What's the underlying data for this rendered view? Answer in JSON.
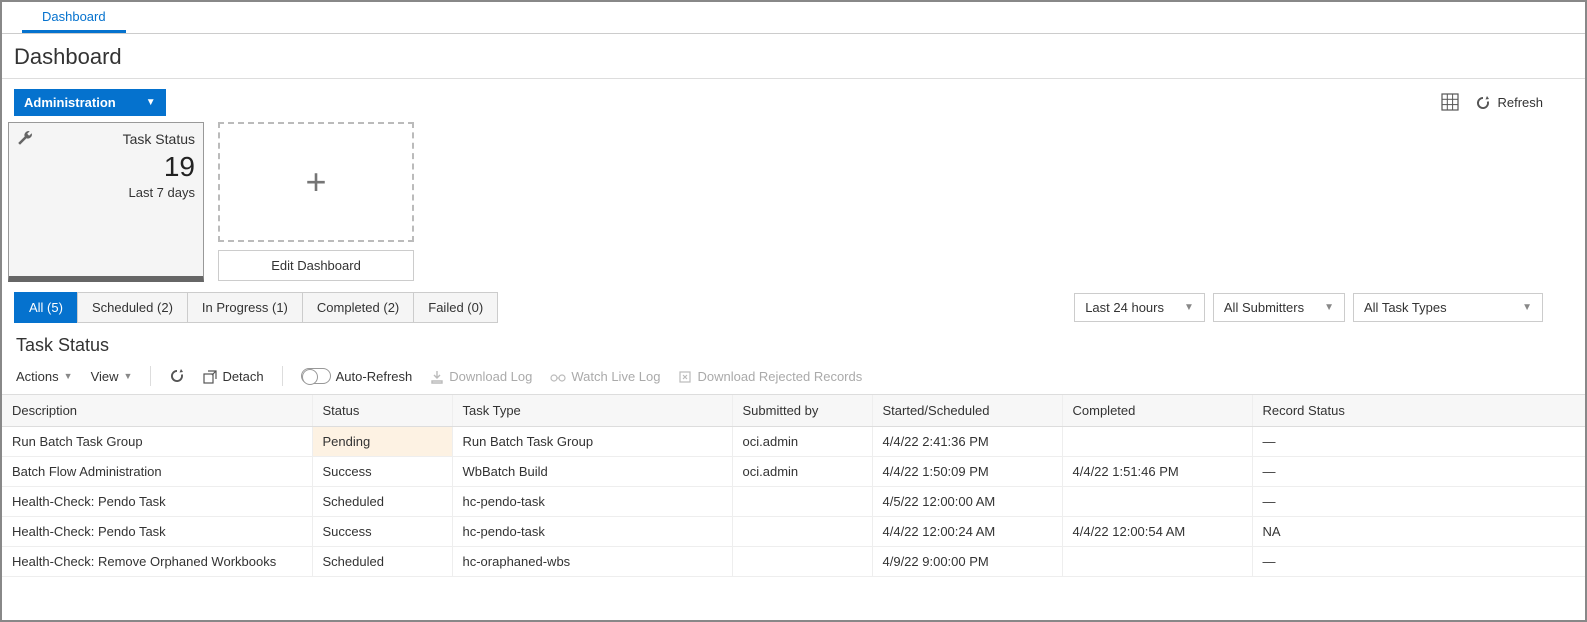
{
  "top_tab": "Dashboard",
  "page_title": "Dashboard",
  "admin_dropdown": "Administration",
  "refresh_label": "Refresh",
  "tile": {
    "title": "Task Status",
    "number": "19",
    "subtitle": "Last 7 days"
  },
  "edit_dashboard": "Edit Dashboard",
  "filter_tabs": {
    "all": "All (5)",
    "scheduled": "Scheduled (2)",
    "inprogress": "In Progress (1)",
    "completed": "Completed (2)",
    "failed": "Failed (0)"
  },
  "selects": {
    "time": "Last 24 hours",
    "submitters": "All Submitters",
    "tasktypes": "All Task Types"
  },
  "section_title": "Task Status",
  "actions": {
    "actions": "Actions",
    "view": "View",
    "detach": "Detach",
    "autorefresh": "Auto-Refresh",
    "downloadlog": "Download Log",
    "watchlive": "Watch Live Log",
    "downloadrej": "Download Rejected Records"
  },
  "columns": {
    "description": "Description",
    "status": "Status",
    "tasktype": "Task Type",
    "submittedby": "Submitted by",
    "started": "Started/Scheduled",
    "completed": "Completed",
    "record": "Record Status"
  },
  "rows": [
    {
      "description": "Run Batch Task Group",
      "status": "Pending",
      "status_class": "cell-pending",
      "tasktype": "Run Batch Task Group",
      "submittedby": "oci.admin",
      "started": "4/4/22 2:41:36 PM",
      "completed": "",
      "record": "—"
    },
    {
      "description": "Batch Flow Administration",
      "status": "Success",
      "status_class": "",
      "tasktype": "WbBatch Build",
      "submittedby": "oci.admin",
      "started": "4/4/22 1:50:09 PM",
      "completed": "4/4/22 1:51:46 PM",
      "record": "—"
    },
    {
      "description": "Health-Check: Pendo Task",
      "status": "Scheduled",
      "status_class": "",
      "tasktype": "hc-pendo-task",
      "submittedby": "",
      "started": "4/5/22 12:00:00 AM",
      "completed": "",
      "record": "—"
    },
    {
      "description": "Health-Check: Pendo Task",
      "status": "Success",
      "status_class": "",
      "tasktype": "hc-pendo-task",
      "submittedby": "",
      "started": "4/4/22 12:00:24 AM",
      "completed": "4/4/22 12:00:54 AM",
      "record": "NA"
    },
    {
      "description": "Health-Check: Remove Orphaned Workbooks",
      "status": "Scheduled",
      "status_class": "",
      "tasktype": "hc-oraphaned-wbs",
      "submittedby": "",
      "started": "4/9/22 9:00:00 PM",
      "completed": "",
      "record": "—"
    }
  ]
}
